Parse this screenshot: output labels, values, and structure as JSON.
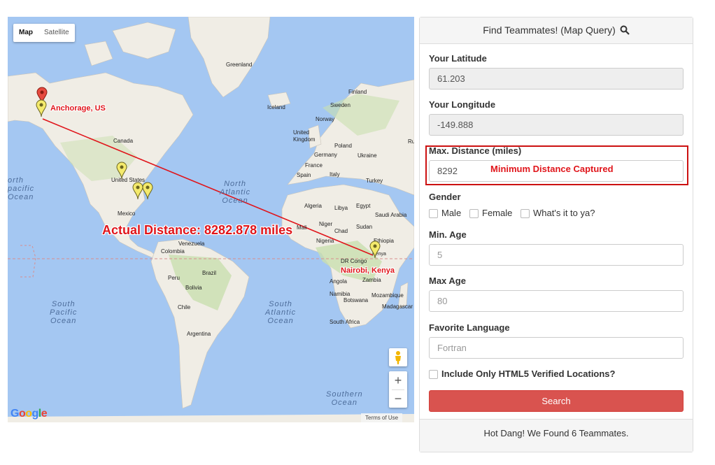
{
  "map": {
    "type_control": {
      "map": "Map",
      "satellite": "Satellite"
    },
    "labels": {
      "greenland": "Greenland",
      "iceland": "Iceland",
      "finland": "Finland",
      "sweden": "Sweden",
      "norway": "Norway",
      "united_kingdom": "United\nKingdom",
      "poland": "Poland",
      "germany": "Germany",
      "ukraine": "Ukraine",
      "france": "France",
      "spain": "Spain",
      "italy": "Italy",
      "turkey": "Turkey",
      "algeria": "Algeria",
      "libya": "Libya",
      "egypt": "Egypt",
      "saudi_arabia": "Saudi Arabia",
      "mali": "Mali",
      "niger": "Niger",
      "chad": "Chad",
      "sudan": "Sudan",
      "nigeria": "Nigeria",
      "ethiopia": "Ethiopia",
      "dr_congo": "DR Congo",
      "kenya": "Kenya",
      "angola": "Angola",
      "namibia": "Namibia",
      "zambia": "Zambia",
      "botswana": "Botswana",
      "mozambique": "Mozambique",
      "madagascar": "Madagascar",
      "south_africa": "South Africa",
      "canada": "Canada",
      "united_states": "United States",
      "mexico": "Mexico",
      "venezuela": "Venezuela",
      "colombia": "Colombia",
      "peru": "Peru",
      "brazil": "Brazil",
      "bolivia": "Bolivia",
      "chile": "Chile",
      "argentina": "Argentina",
      "russia_fragment": "Ru",
      "north_pacific_fragment": "orth\npacific\nOcean",
      "north_atlantic": "North\nAtlantic\nOcean",
      "south_pacific": "South\nPacific\nOcean",
      "south_atlantic": "South\nAtlantic\nOcean",
      "southern_ocean": "Southern\nOcean"
    },
    "annotations": {
      "anchorage": "Anchorage, US",
      "nairobi": "Nairobi, Kenya",
      "actual_distance": "Actual Distance: 8282.878 miles"
    },
    "zoom_in": "+",
    "zoom_out": "−",
    "google_logo": "Google",
    "terms": "Terms of Use",
    "colors": {
      "water": "#a4c7f2",
      "land": "#f0ede5",
      "vegetation": "#c9dfaf",
      "line": "#e0151b"
    }
  },
  "panel": {
    "title": "Find Teammates! (Map Query)",
    "latitude": {
      "label": "Your Latitude",
      "value": "61.203"
    },
    "longitude": {
      "label": "Your Longitude",
      "value": "-149.888"
    },
    "distance": {
      "label": "Max. Distance (miles)",
      "value": "8292",
      "annotation": "Minimum Distance Captured"
    },
    "gender": {
      "label": "Gender",
      "options": [
        "Male",
        "Female",
        "What's it to ya?"
      ]
    },
    "min_age": {
      "label": "Min. Age",
      "placeholder": "5"
    },
    "max_age": {
      "label": "Max Age",
      "placeholder": "80"
    },
    "language": {
      "label": "Favorite Language",
      "placeholder": "Fortran"
    },
    "html5_verified": "Include Only HTML5 Verified Locations?",
    "search_button": "Search",
    "footer": "Hot Dang! We Found 6 Teammates."
  }
}
